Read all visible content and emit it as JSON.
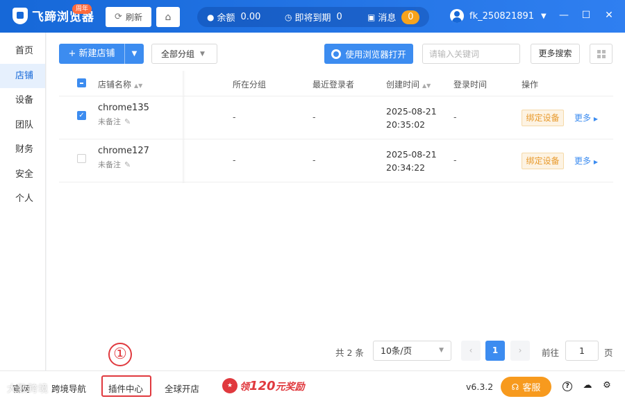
{
  "app": {
    "brand": "飞蹄浏览器",
    "anniversary_badge": "周年"
  },
  "titlebar": {
    "refresh_label": "刷新",
    "balance_label": "余额",
    "balance_value": "0.00",
    "expiring_label": "即将到期",
    "expiring_value": "0",
    "messages_label": "消息",
    "messages_count": "0",
    "username": "fk_250821891"
  },
  "sidebar": {
    "items": [
      {
        "label": "首页"
      },
      {
        "label": "店铺"
      },
      {
        "label": "设备"
      },
      {
        "label": "团队"
      },
      {
        "label": "财务"
      },
      {
        "label": "安全"
      },
      {
        "label": "个人"
      }
    ],
    "active_index": 1
  },
  "toolbar": {
    "new_shop_label": "+ 新建店铺",
    "group_select": "全部分组",
    "open_browser_label": "使用浏览器打开",
    "search_placeholder": "请输入关键词",
    "more_search_label": "更多搜索"
  },
  "table": {
    "columns": [
      "店铺名称",
      "所在分组",
      "最近登录者",
      "创建时间",
      "登录时间",
      "操作"
    ],
    "rows": [
      {
        "checked": true,
        "name": "chrome135",
        "note": "未备注",
        "group": "-",
        "last_login_user": "-",
        "created_date": "2025-08-21",
        "created_time": "20:35:02",
        "login_time": "-",
        "action_bind": "绑定设备",
        "action_more": "更多"
      },
      {
        "checked": false,
        "name": "chrome127",
        "note": "未备注",
        "group": "-",
        "last_login_user": "-",
        "created_date": "2025-08-21",
        "created_time": "20:34:22",
        "login_time": "-",
        "action_bind": "绑定设备",
        "action_more": "更多"
      }
    ]
  },
  "pagination": {
    "total_text": "共 2 条",
    "page_size": "10条/页",
    "current_page": "1",
    "goto_label": "前往",
    "goto_value": "1",
    "page_unit": "页"
  },
  "footer": {
    "links": [
      "官网",
      "跨境导航",
      "插件中心",
      "全球开店"
    ],
    "reward_prefix": "领",
    "reward_amount": "120",
    "reward_suffix": "元奖励",
    "version": "v6.3.2",
    "service_label": "客服"
  },
  "annotation": {
    "marker": "①"
  },
  "watermark": "大数跨境",
  "colors": {
    "primary": "#3c8cf0",
    "titlebar": "#1668d8",
    "warning": "#f79a1e",
    "highlight": "#e0393e"
  }
}
